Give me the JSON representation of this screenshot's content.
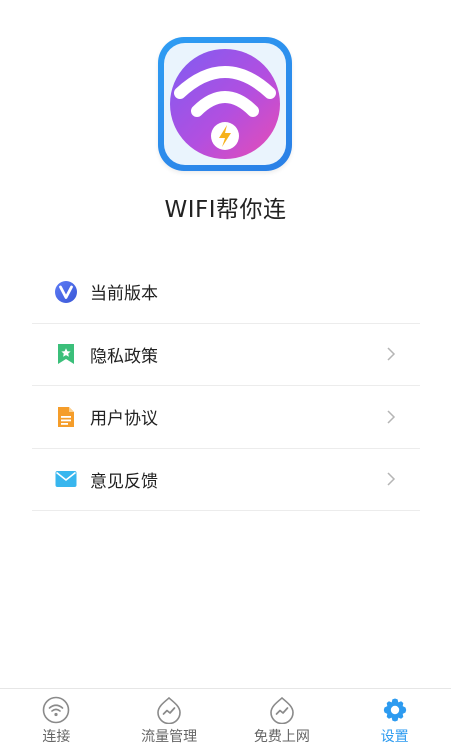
{
  "app": {
    "name": "WIFI帮你连"
  },
  "menu": {
    "items": [
      {
        "label": "当前版本",
        "icon": "version-v-icon",
        "has_chevron": false
      },
      {
        "label": "隐私政策",
        "icon": "bookmark-star-icon",
        "has_chevron": true
      },
      {
        "label": "用户协议",
        "icon": "document-icon",
        "has_chevron": true
      },
      {
        "label": "意见反馈",
        "icon": "envelope-icon",
        "has_chevron": true
      }
    ]
  },
  "tabbar": {
    "tabs": [
      {
        "label": "连接",
        "icon": "wifi-icon",
        "active": false
      },
      {
        "label": "流量管理",
        "icon": "traffic-icon",
        "active": false
      },
      {
        "label": "免费上网",
        "icon": "traffic-icon",
        "active": false
      },
      {
        "label": "设置",
        "icon": "gear-icon",
        "active": true
      }
    ]
  },
  "colors": {
    "accent": "#2d9bf0",
    "logo_border": "#2a8ef0",
    "divider": "#ececec",
    "inactive_tab_text": "#666666"
  }
}
